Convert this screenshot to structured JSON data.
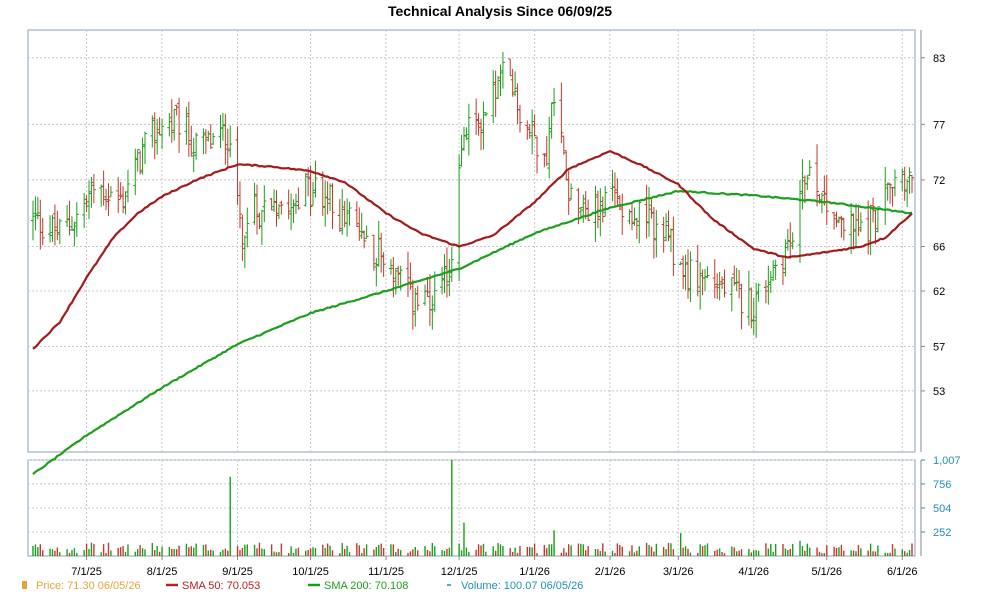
{
  "chart_data": {
    "type": "ohlc",
    "title": "Technical Analysis Since 06/09/25",
    "price_axis": {
      "ticks": [
        83,
        77,
        72,
        66,
        62,
        57,
        53
      ],
      "labels": [
        "83",
        "77",
        "72",
        "66",
        "62",
        "57",
        "53"
      ],
      "range": [
        47.5,
        85.5
      ]
    },
    "volume_axis": {
      "ticks": [
        252,
        504,
        756,
        1007
      ],
      "labels": [
        "252",
        "504",
        "756",
        "1,007"
      ],
      "range": [
        0,
        1007
      ]
    },
    "x_axis": {
      "start": "2025-06-09",
      "end": "2026-06-05",
      "labels": [
        {
          "date": "2025-07-01",
          "text": "7/1/25"
        },
        {
          "date": "2025-08-01",
          "text": "8/1/25"
        },
        {
          "date": "2025-09-01",
          "text": "9/1/25"
        },
        {
          "date": "2025-10-01",
          "text": "10/1/25"
        },
        {
          "date": "2025-11-01",
          "text": "11/1/25"
        },
        {
          "date": "2025-12-01",
          "text": "12/1/25"
        },
        {
          "date": "2026-01-01",
          "text": "1/1/26"
        },
        {
          "date": "2026-02-01",
          "text": "2/1/26"
        },
        {
          "date": "2026-03-01",
          "text": "3/1/26"
        },
        {
          "date": "2026-04-01",
          "text": "4/1/26"
        },
        {
          "date": "2026-05-01",
          "text": "5/1/26"
        },
        {
          "date": "2026-06-01",
          "text": "6/1/26"
        }
      ]
    },
    "price_anchors": [
      [
        "2025-06-09",
        68.5
      ],
      [
        "2025-06-20",
        67.2
      ],
      [
        "2025-06-28",
        69.0
      ],
      [
        "2025-07-05",
        71.5
      ],
      [
        "2025-07-15",
        70.0
      ],
      [
        "2025-07-24",
        74.5
      ],
      [
        "2025-07-31",
        76.8
      ],
      [
        "2025-08-08",
        77.2
      ],
      [
        "2025-08-15",
        74.8
      ],
      [
        "2025-08-22",
        75.5
      ],
      [
        "2025-08-29",
        76.2
      ],
      [
        "2025-09-03",
        67.0
      ],
      [
        "2025-09-08",
        69.0
      ],
      [
        "2025-09-15",
        70.2
      ],
      [
        "2025-09-25",
        70.8
      ],
      [
        "2025-10-05",
        71.0
      ],
      [
        "2025-10-15",
        68.5
      ],
      [
        "2025-10-25",
        66.5
      ],
      [
        "2025-11-02",
        64.5
      ],
      [
        "2025-11-10",
        61.5
      ],
      [
        "2025-11-20",
        60.2
      ],
      [
        "2025-11-27",
        63.5
      ],
      [
        "2025-12-02",
        75.5
      ],
      [
        "2025-12-10",
        77.5
      ],
      [
        "2025-12-20",
        81.8
      ],
      [
        "2025-12-28",
        76.8
      ],
      [
        "2026-01-06",
        74.5
      ],
      [
        "2026-01-09",
        80.0
      ],
      [
        "2026-01-15",
        71.5
      ],
      [
        "2026-01-25",
        69.0
      ],
      [
        "2026-02-02",
        70.5
      ],
      [
        "2026-02-12",
        69.0
      ],
      [
        "2026-02-22",
        67.5
      ],
      [
        "2026-03-05",
        63.5
      ],
      [
        "2026-03-15",
        63.0
      ],
      [
        "2026-03-25",
        61.5
      ],
      [
        "2026-04-01",
        60.8
      ],
      [
        "2026-04-10",
        64.5
      ],
      [
        "2026-04-18",
        67.0
      ],
      [
        "2026-04-23",
        73.5
      ],
      [
        "2026-05-01",
        70.0
      ],
      [
        "2026-05-10",
        67.5
      ],
      [
        "2026-05-18",
        68.0
      ],
      [
        "2026-05-25",
        70.5
      ],
      [
        "2026-06-01",
        72.5
      ],
      [
        "2026-06-05",
        71.3
      ]
    ],
    "sma50_anchors": [
      [
        "2025-06-09",
        56.8
      ],
      [
        "2025-06-20",
        59.2
      ],
      [
        "2025-07-01",
        63.2
      ],
      [
        "2025-07-12",
        66.8
      ],
      [
        "2025-07-22",
        69.0
      ],
      [
        "2025-08-01",
        70.5
      ],
      [
        "2025-08-15",
        72.0
      ],
      [
        "2025-09-01",
        73.4
      ],
      [
        "2025-09-15",
        73.2
      ],
      [
        "2025-10-01",
        72.8
      ],
      [
        "2025-10-15",
        71.8
      ],
      [
        "2025-11-01",
        69.0
      ],
      [
        "2025-11-15",
        67.2
      ],
      [
        "2025-12-01",
        66.0
      ],
      [
        "2025-12-15",
        67.0
      ],
      [
        "2026-01-01",
        70.0
      ],
      [
        "2026-01-15",
        73.0
      ],
      [
        "2026-02-01",
        74.6
      ],
      [
        "2026-02-15",
        73.2
      ],
      [
        "2026-03-01",
        71.6
      ],
      [
        "2026-03-15",
        68.5
      ],
      [
        "2026-04-01",
        65.8
      ],
      [
        "2026-04-15",
        65.0
      ],
      [
        "2026-05-01",
        65.5
      ],
      [
        "2026-05-15",
        66.0
      ],
      [
        "2026-05-25",
        66.8
      ],
      [
        "2026-06-05",
        69.0
      ]
    ],
    "sma200_anchors": [
      [
        "2025-06-09",
        45.5
      ],
      [
        "2025-07-01",
        49.0
      ],
      [
        "2025-08-01",
        53.3
      ],
      [
        "2025-09-01",
        57.2
      ],
      [
        "2025-10-01",
        60.0
      ],
      [
        "2025-11-01",
        62.0
      ],
      [
        "2025-12-01",
        64.0
      ],
      [
        "2026-01-01",
        67.2
      ],
      [
        "2026-02-01",
        69.5
      ],
      [
        "2026-03-01",
        71.0
      ],
      [
        "2026-04-01",
        70.6
      ],
      [
        "2026-05-01",
        70.0
      ],
      [
        "2026-06-05",
        69.0
      ]
    ],
    "volume_spikes": [
      [
        "2025-08-29",
        830
      ],
      [
        "2025-11-28",
        1007
      ],
      [
        "2025-12-03",
        350
      ],
      [
        "2026-01-09",
        270
      ],
      [
        "2026-05-23",
        250
      ],
      [
        "2026-03-02",
        240
      ],
      [
        "2026-04-20",
        160
      ]
    ],
    "legend": [
      {
        "key": "price",
        "label": "Price: 71.30  06/05/26",
        "color": "#e8a33c"
      },
      {
        "key": "sma50",
        "label": "SMA 50: 70.053",
        "color": "#b22222"
      },
      {
        "key": "sma200",
        "label": "SMA 200: 70.108",
        "color": "#1a9e1a"
      },
      {
        "key": "volume",
        "label": "Volume: 100.07  06/05/26",
        "color": "#1e90b4"
      }
    ],
    "colors": {
      "up": "#1a9e1a",
      "down": "#c0392b",
      "sma50": "#a01b1b",
      "sma200": "#1e9e1e",
      "grid": "#c8c8c8",
      "vol_axis": "#1e90b4"
    }
  }
}
